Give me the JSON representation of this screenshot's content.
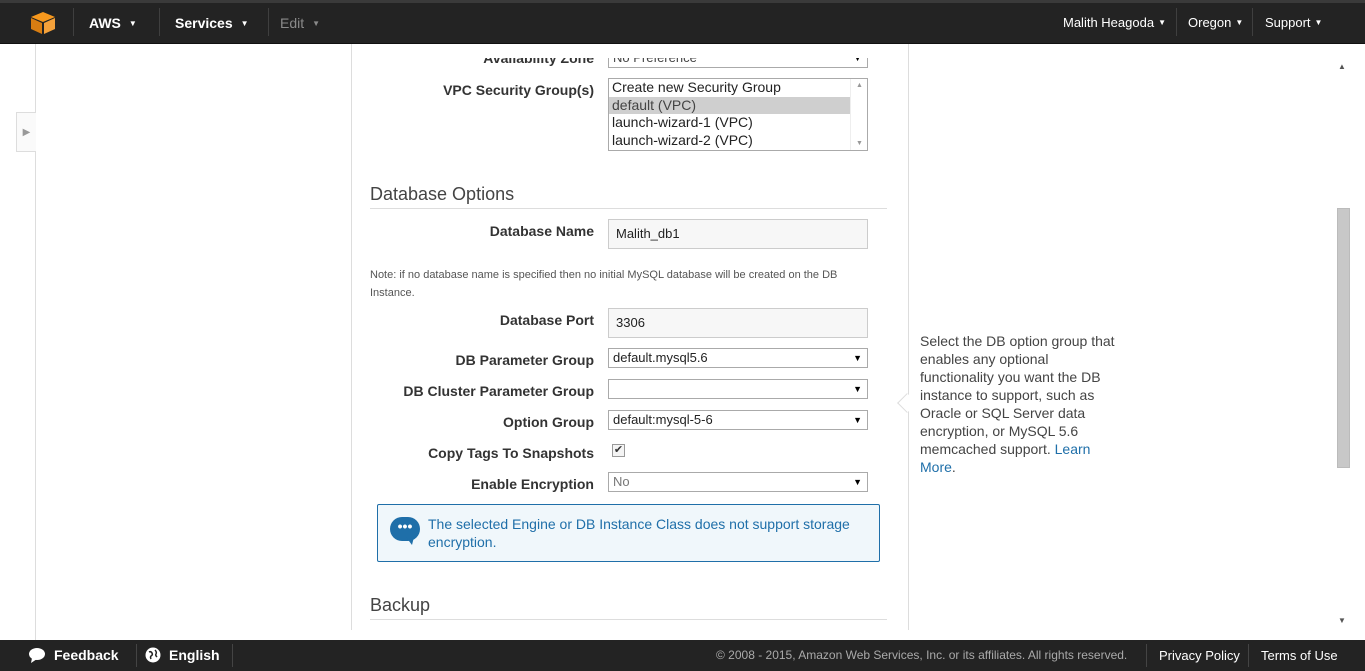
{
  "topnav": {
    "brand": "AWS",
    "services": "Services",
    "edit": "Edit",
    "user": "Malith Heagoda",
    "region": "Oregon",
    "support": "Support"
  },
  "form": {
    "availability_zone_label": "Availability Zone",
    "availability_zone_value": "No Preference",
    "vpc_sg_label": "VPC Security Group(s)",
    "vpc_sg_options": [
      "Create new Security Group",
      "default (VPC)",
      "launch-wizard-1 (VPC)",
      "launch-wizard-2 (VPC)"
    ],
    "db_options_title": "Database Options",
    "db_name_label": "Database Name",
    "db_name_value": "Malith_db1",
    "note": "Note: if no database name is specified then no initial MySQL database will be created on the DB Instance.",
    "db_port_label": "Database Port",
    "db_port_value": "3306",
    "param_group_label": "DB Parameter Group",
    "param_group_value": "default.mysql5.6",
    "cluster_param_group_label": "DB Cluster Parameter Group",
    "cluster_param_group_value": "",
    "option_group_label": "Option Group",
    "option_group_value": "default:mysql-5-6",
    "copy_tags_label": "Copy Tags To Snapshots",
    "copy_tags_checked": true,
    "encryption_label": "Enable Encryption",
    "encryption_value": "No",
    "info_message": "The selected Engine or DB Instance Class does not support storage encryption.",
    "backup_title": "Backup"
  },
  "help": {
    "text": "Select the DB option group that enables any optional functionality you want the DB instance to support, such as Oracle or SQL Server data encryption, or MySQL 5.6 memcached support.",
    "link_text": "Learn More",
    "trailing": "."
  },
  "footer": {
    "feedback": "Feedback",
    "language": "English",
    "copyright": "© 2008 - 2015, Amazon Web Services, Inc. or its affiliates. All rights reserved.",
    "privacy": "Privacy Policy",
    "terms": "Terms of Use"
  },
  "colors": {
    "nav_bg": "#232323",
    "accent_blue": "#1f6fa9",
    "aws_orange": "#f7981d"
  },
  "icons": [
    "aws-cube-icon",
    "chevron-down-icon",
    "expand-arrow-icon",
    "chat-bubble-icon",
    "feedback-icon",
    "globe-icon",
    "dropdown-arrow-icon"
  ]
}
